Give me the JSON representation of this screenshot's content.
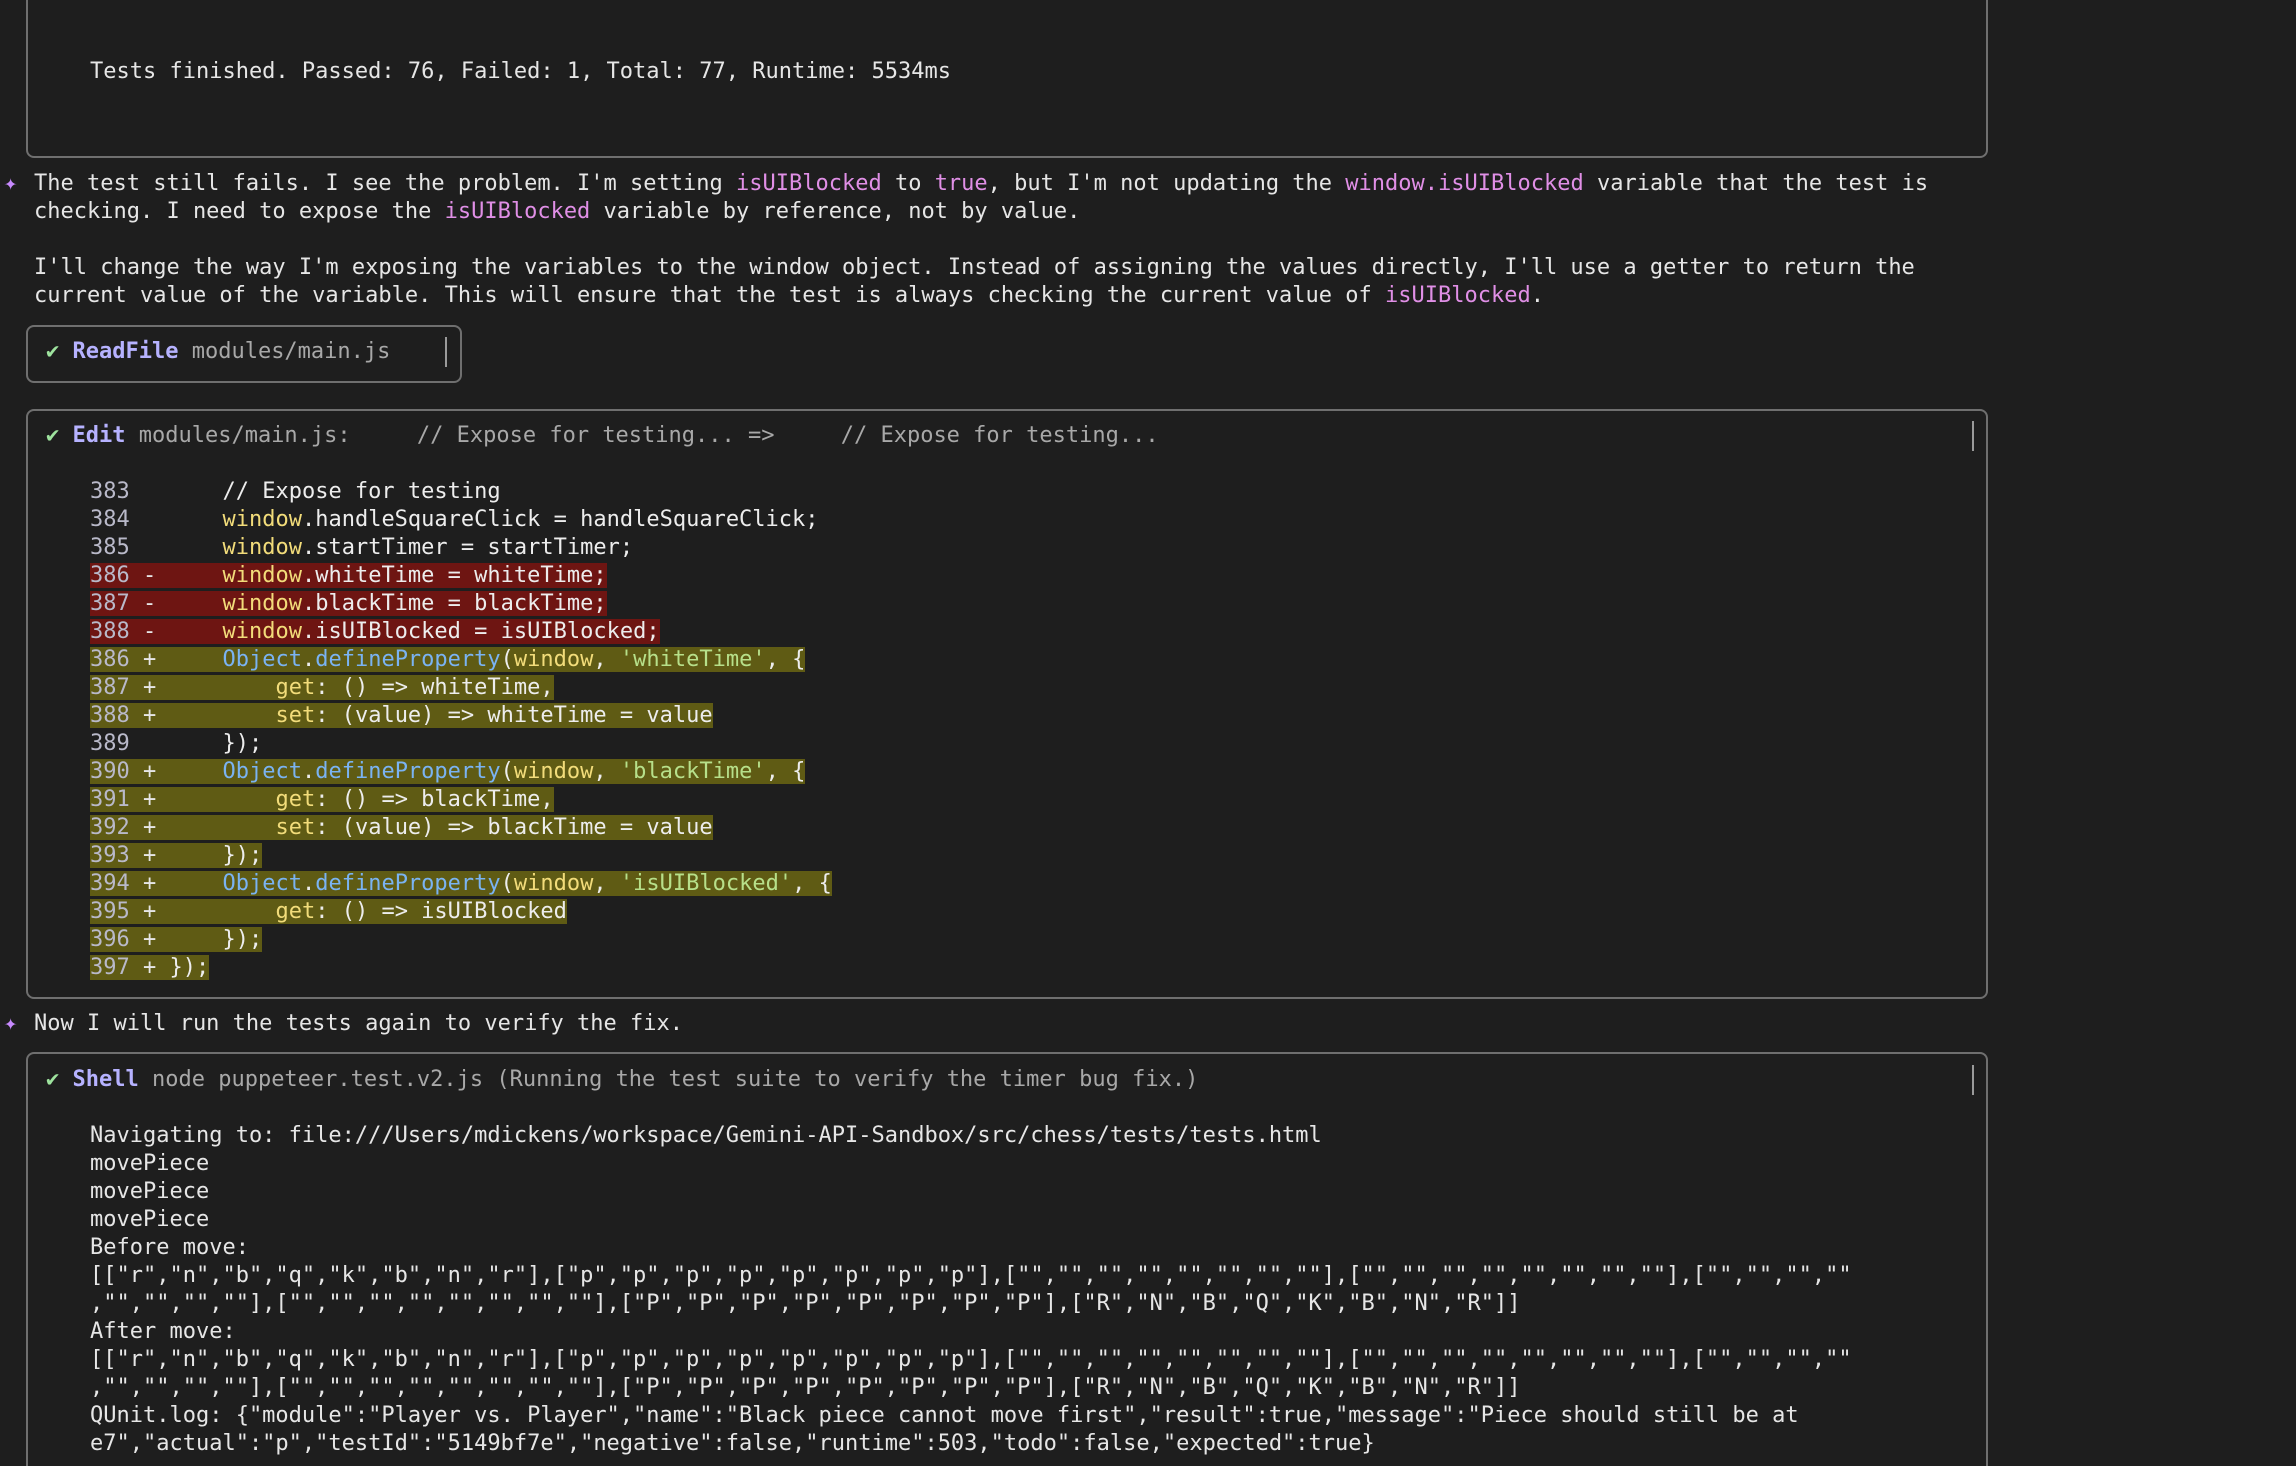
{
  "test_result_box": {
    "summary": "Tests finished. Passed: 76, Failed: 1, Total: 77, Runtime: 5534ms"
  },
  "message1": {
    "icon": "sparkle-icon",
    "line1_a": "The test still fails. I see the problem. I'm setting ",
    "line1_hl1": "isUIBlocked",
    "line1_b": " to ",
    "line1_hl2": "true",
    "line1_c": ", but I'm not updating the ",
    "line1_hl3": "window.isUIBlocked",
    "line1_d": " variable that the test is",
    "line2_a": "checking. I need to expose the ",
    "line2_hl": "isUIBlocked",
    "line2_b": " variable by reference, not by value.",
    "line3": "I'll change the way I'm exposing the variables to the window object. Instead of assigning the values directly, I'll use a getter to return the",
    "line4_a": "current value of the variable. This will ensure that the test is always checking the current value of ",
    "line4_hl": "isUIBlocked",
    "line4_b": "."
  },
  "readfile_tool": {
    "status_icon": "✔",
    "name": "ReadFile",
    "arg": "modules/main.js"
  },
  "edit_tool": {
    "status_icon": "✔",
    "name": "Edit",
    "arg": "modules/main.js:     // Expose for testing... =>     // Expose for testing...",
    "lines": [
      {
        "num": "383",
        "sign": " ",
        "text": "    // Expose for testing"
      },
      {
        "num": "384",
        "sign": " ",
        "text": "    window.handleSquareClick = handleSquareClick;"
      },
      {
        "num": "385",
        "sign": " ",
        "text": "    window.startTimer = startTimer;"
      },
      {
        "num": "386",
        "sign": "-",
        "text": "    window.whiteTime = whiteTime;"
      },
      {
        "num": "387",
        "sign": "-",
        "text": "    window.blackTime = blackTime;"
      },
      {
        "num": "388",
        "sign": "-",
        "text": "    window.isUIBlocked = isUIBlocked;"
      },
      {
        "num": "386",
        "sign": "+",
        "text": "    Object.defineProperty(window, 'whiteTime', {"
      },
      {
        "num": "387",
        "sign": "+",
        "text": "        get: () => whiteTime,"
      },
      {
        "num": "388",
        "sign": "+",
        "text": "        set: (value) => whiteTime = value"
      },
      {
        "num": "389",
        "sign": " ",
        "text": "    });"
      },
      {
        "num": "390",
        "sign": "+",
        "text": "    Object.defineProperty(window, 'blackTime', {"
      },
      {
        "num": "391",
        "sign": "+",
        "text": "        get: () => blackTime,"
      },
      {
        "num": "392",
        "sign": "+",
        "text": "        set: (value) => blackTime = value"
      },
      {
        "num": "393",
        "sign": "+",
        "text": "    });"
      },
      {
        "num": "394",
        "sign": "+",
        "text": "    Object.defineProperty(window, 'isUIBlocked', {"
      },
      {
        "num": "395",
        "sign": "+",
        "text": "        get: () => isUIBlocked"
      },
      {
        "num": "396",
        "sign": "+",
        "text": "    });"
      },
      {
        "num": "397",
        "sign": "+",
        "text": "});"
      }
    ]
  },
  "message2": {
    "icon": "sparkle-icon",
    "text": "Now I will run the tests again to verify the fix."
  },
  "shell_tool": {
    "status_icon": "✔",
    "name": "Shell",
    "arg": "node puppeteer.test.v2.js (Running the test suite to verify the timer bug fix.)",
    "output": [
      "Navigating to: file:///Users/mdickens/workspace/Gemini-API-Sandbox/src/chess/tests/tests.html",
      "movePiece",
      "movePiece",
      "movePiece",
      "Before move:",
      "[[\"r\",\"n\",\"b\",\"q\",\"k\",\"b\",\"n\",\"r\"],[\"p\",\"p\",\"p\",\"p\",\"p\",\"p\",\"p\",\"p\"],[\"\",\"\",\"\",\"\",\"\",\"\",\"\",\"\"],[\"\",\"\",\"\",\"\",\"\",\"\",\"\",\"\"],[\"\",\"\",\"\",\"\"",
      ",\"\",\"\",\"\",\"\"],[\"\",\"\",\"\",\"\",\"\",\"\",\"\",\"\"],[\"P\",\"P\",\"P\",\"P\",\"P\",\"P\",\"P\",\"P\"],[\"R\",\"N\",\"B\",\"Q\",\"K\",\"B\",\"N\",\"R\"]]",
      "After move:",
      "[[\"r\",\"n\",\"b\",\"q\",\"k\",\"b\",\"n\",\"r\"],[\"p\",\"p\",\"p\",\"p\",\"p\",\"p\",\"p\",\"p\"],[\"\",\"\",\"\",\"\",\"\",\"\",\"\",\"\"],[\"\",\"\",\"\",\"\",\"\",\"\",\"\",\"\"],[\"\",\"\",\"\",\"\"",
      ",\"\",\"\",\"\",\"\"],[\"\",\"\",\"\",\"\",\"\",\"\",\"\",\"\"],[\"P\",\"P\",\"P\",\"P\",\"P\",\"P\",\"P\",\"P\"],[\"R\",\"N\",\"B\",\"Q\",\"K\",\"B\",\"N\",\"R\"]]",
      "QUnit.log: {\"module\":\"Player vs. Player\",\"name\":\"Black piece cannot move first\",\"result\":true,\"message\":\"Piece should still be at",
      "e7\",\"actual\":\"p\",\"testId\":\"5149bf7e\",\"negative\":false,\"runtime\":503,\"todo\":false,\"expected\":true}"
    ]
  },
  "colors": {
    "background": "#1e1e1e",
    "border": "#6f6f6f",
    "highlight": "#e08fe6",
    "tool_name": "#b6b2ff",
    "check": "#9ee39e",
    "deleted_line_bg": "#6e1512",
    "added_line_bg": "#5f5b14"
  }
}
